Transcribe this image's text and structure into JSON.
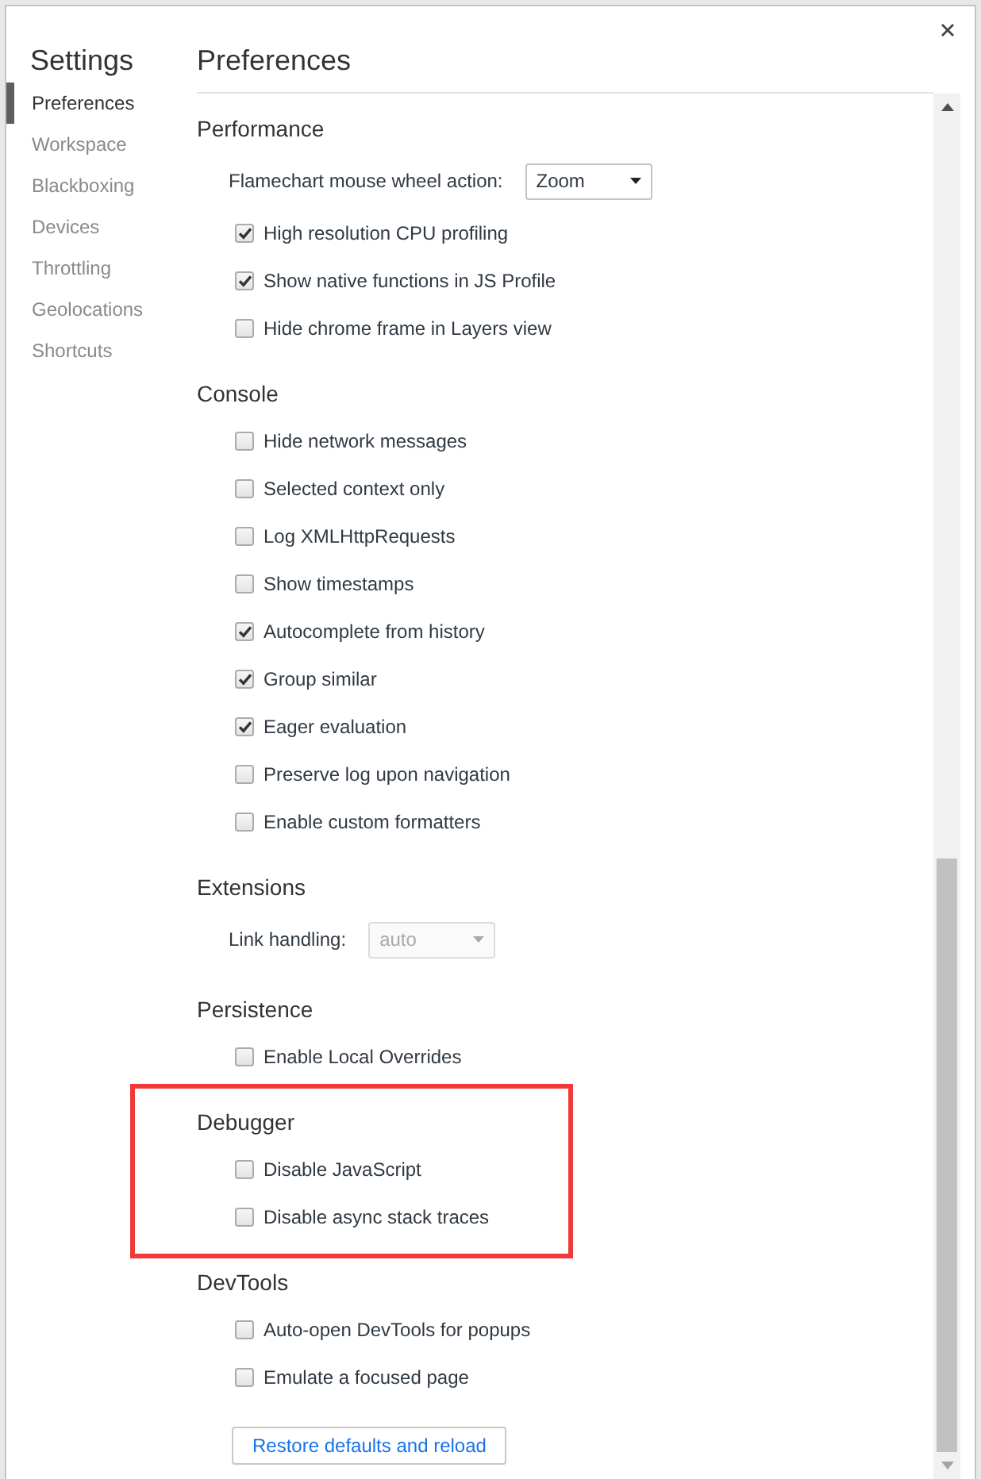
{
  "sidebar": {
    "title": "Settings",
    "items": [
      {
        "label": "Preferences",
        "selected": true
      },
      {
        "label": "Workspace",
        "selected": false
      },
      {
        "label": "Blackboxing",
        "selected": false
      },
      {
        "label": "Devices",
        "selected": false
      },
      {
        "label": "Throttling",
        "selected": false
      },
      {
        "label": "Geolocations",
        "selected": false
      },
      {
        "label": "Shortcuts",
        "selected": false
      }
    ]
  },
  "page": {
    "title": "Preferences"
  },
  "sections": [
    {
      "title": "Performance",
      "highlighted": false,
      "rows": [
        {
          "kind": "select",
          "label": "Flamechart mouse wheel action:",
          "value": "Zoom",
          "disabled": false
        },
        {
          "kind": "checkbox",
          "label": "High resolution CPU profiling",
          "checked": true
        },
        {
          "kind": "checkbox",
          "label": "Show native functions in JS Profile",
          "checked": true
        },
        {
          "kind": "checkbox",
          "label": "Hide chrome frame in Layers view",
          "checked": false
        }
      ]
    },
    {
      "title": "Console",
      "highlighted": false,
      "rows": [
        {
          "kind": "checkbox",
          "label": "Hide network messages",
          "checked": false
        },
        {
          "kind": "checkbox",
          "label": "Selected context only",
          "checked": false
        },
        {
          "kind": "checkbox",
          "label": "Log XMLHttpRequests",
          "checked": false
        },
        {
          "kind": "checkbox",
          "label": "Show timestamps",
          "checked": false
        },
        {
          "kind": "checkbox",
          "label": "Autocomplete from history",
          "checked": true
        },
        {
          "kind": "checkbox",
          "label": "Group similar",
          "checked": true
        },
        {
          "kind": "checkbox",
          "label": "Eager evaluation",
          "checked": true
        },
        {
          "kind": "checkbox",
          "label": "Preserve log upon navigation",
          "checked": false
        },
        {
          "kind": "checkbox",
          "label": "Enable custom formatters",
          "checked": false
        }
      ]
    },
    {
      "title": "Extensions",
      "highlighted": false,
      "rows": [
        {
          "kind": "select",
          "label": "Link handling:",
          "value": "auto",
          "disabled": true
        }
      ]
    },
    {
      "title": "Persistence",
      "highlighted": false,
      "rows": [
        {
          "kind": "checkbox",
          "label": "Enable Local Overrides",
          "checked": false
        }
      ]
    },
    {
      "title": "Debugger",
      "highlighted": true,
      "rows": [
        {
          "kind": "checkbox",
          "label": "Disable JavaScript",
          "checked": false
        },
        {
          "kind": "checkbox",
          "label": "Disable async stack traces",
          "checked": false
        }
      ]
    },
    {
      "title": "DevTools",
      "highlighted": false,
      "rows": [
        {
          "kind": "checkbox",
          "label": "Auto-open DevTools for popups",
          "checked": false
        },
        {
          "kind": "checkbox",
          "label": "Emulate a focused page",
          "checked": false
        }
      ]
    }
  ],
  "footer": {
    "button": "Restore defaults and reload"
  }
}
